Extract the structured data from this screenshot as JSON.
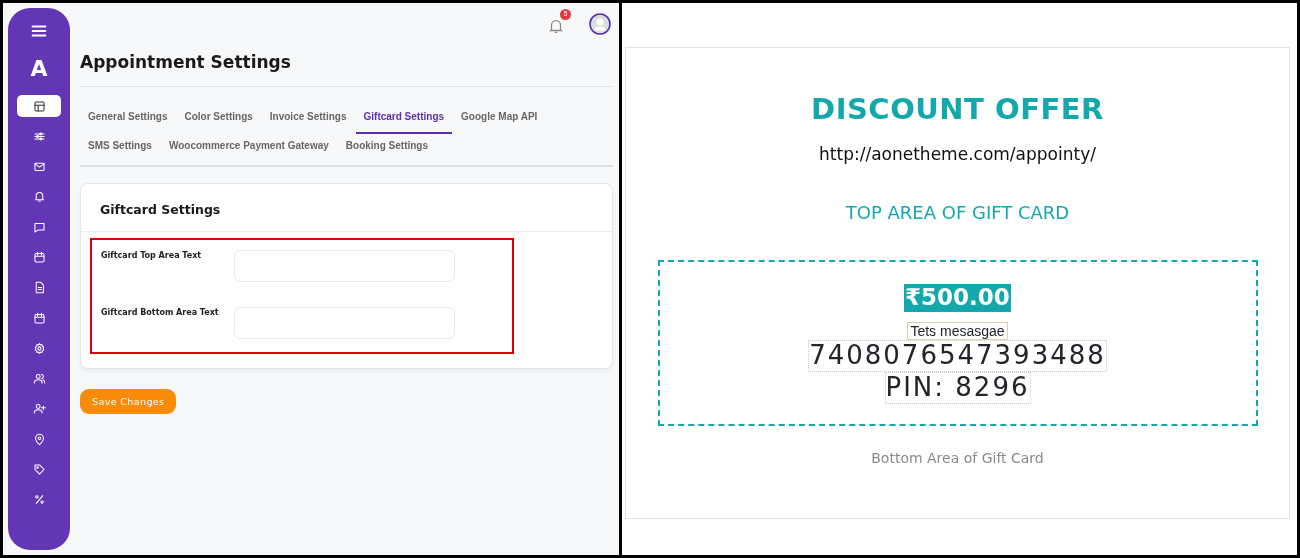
{
  "sidebar": {
    "logo": "A",
    "items": [
      {
        "kind": "layout",
        "selected": true
      },
      {
        "kind": "sliders",
        "selected": false
      },
      {
        "kind": "mail",
        "selected": false
      },
      {
        "kind": "bell",
        "selected": false
      },
      {
        "kind": "chat",
        "selected": false
      },
      {
        "kind": "calendar",
        "selected": false
      },
      {
        "kind": "document",
        "selected": false
      },
      {
        "kind": "calendar",
        "selected": false
      },
      {
        "kind": "gear",
        "selected": false
      },
      {
        "kind": "users",
        "selected": false
      },
      {
        "kind": "user-plus",
        "selected": false
      },
      {
        "kind": "pin",
        "selected": false
      },
      {
        "kind": "tag",
        "selected": false
      },
      {
        "kind": "percent",
        "selected": false
      }
    ]
  },
  "header": {
    "notification_count": "5"
  },
  "page_title": "Appointment Settings",
  "tabs": [
    {
      "label": "General Settings",
      "selected": false
    },
    {
      "label": "Color Settings",
      "selected": false
    },
    {
      "label": "Invoice Settings",
      "selected": false
    },
    {
      "label": "Giftcard Settings",
      "selected": true
    },
    {
      "label": "Google Map API",
      "selected": false
    },
    {
      "label": "SMS Settings",
      "selected": false
    },
    {
      "label": "Woocommerce Payment Gateway",
      "selected": false
    },
    {
      "label": "Booking Settings",
      "selected": false
    }
  ],
  "card": {
    "title": "Giftcard Settings",
    "highlighted": true,
    "fields": [
      {
        "label": "Giftcard Top Area Text"
      },
      {
        "label": "Giftcard Bottom Area Text"
      }
    ]
  },
  "save_button": "Save Changes",
  "preview": {
    "title": "DISCOUNT OFFER",
    "url": "http://aonetheme.com/appointy/",
    "top_text": "TOP AREA OF GIFT CARD",
    "amount": "₹500.00",
    "message": "Tets mesasgae",
    "code": "7408076547393488",
    "pin": "PIN: 8296",
    "bottom_text": "Bottom Area of Gift Card"
  }
}
